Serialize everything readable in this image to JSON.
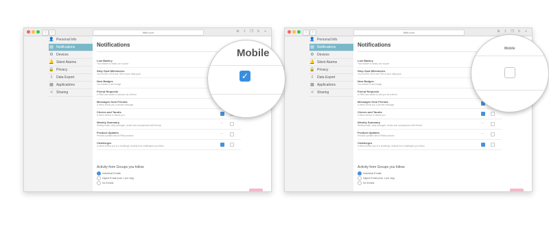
{
  "browser": {
    "url": "fitbit.com"
  },
  "sidebar": {
    "items": [
      {
        "icon": "person-icon",
        "label": "Personal Info",
        "active": false
      },
      {
        "icon": "chat-icon",
        "label": "Notifications",
        "active": true
      },
      {
        "icon": "gear-icon",
        "label": "Devices",
        "active": false
      },
      {
        "icon": "bell-icon",
        "label": "Silent Alarms",
        "active": false
      },
      {
        "icon": "lock-icon",
        "label": "Privacy",
        "active": false
      },
      {
        "icon": "export-icon",
        "label": "Data Export",
        "active": false
      },
      {
        "icon": "grid-icon",
        "label": "Applications",
        "active": false
      },
      {
        "icon": "share-icon",
        "label": "Sharing",
        "active": false
      }
    ]
  },
  "main": {
    "title": "Notifications",
    "column_header": "Mobile",
    "rows": [
      {
        "title": "Low Battery",
        "desc": "Your tracker is nearly out of juice"
      },
      {
        "title": "Step Goal Milestones",
        "desc": "You hit 25%, 50% and 75% of your daily goal"
      },
      {
        "title": "New Badges",
        "desc": "You earned a new badge"
      },
      {
        "title": "Friend Requests",
        "desc": "A Fitbit user wants to add you as a friend"
      },
      {
        "title": "Messages from Friends",
        "desc": "A friend sends you a private message"
      },
      {
        "title": "Cheers and Taunts",
        "desc": "A friend cheers or taunts you"
      },
      {
        "title": "Weekly Summary",
        "desc": "Weekly totals, daily averages, trends and comparisons with friends"
      },
      {
        "title": "Product Updates",
        "desc": "Periodic updates about Fitbit products"
      },
      {
        "title": "Challenges",
        "desc": "A friend invites you to a challenge. Activity from challenges you follow"
      }
    ],
    "groups": {
      "title": "Activity from Groups you follow",
      "options": [
        "Individual Emails",
        "Digest Email (max 1 per day)",
        "No Emails"
      ]
    }
  },
  "magnifier": {
    "label": "Mobile"
  }
}
